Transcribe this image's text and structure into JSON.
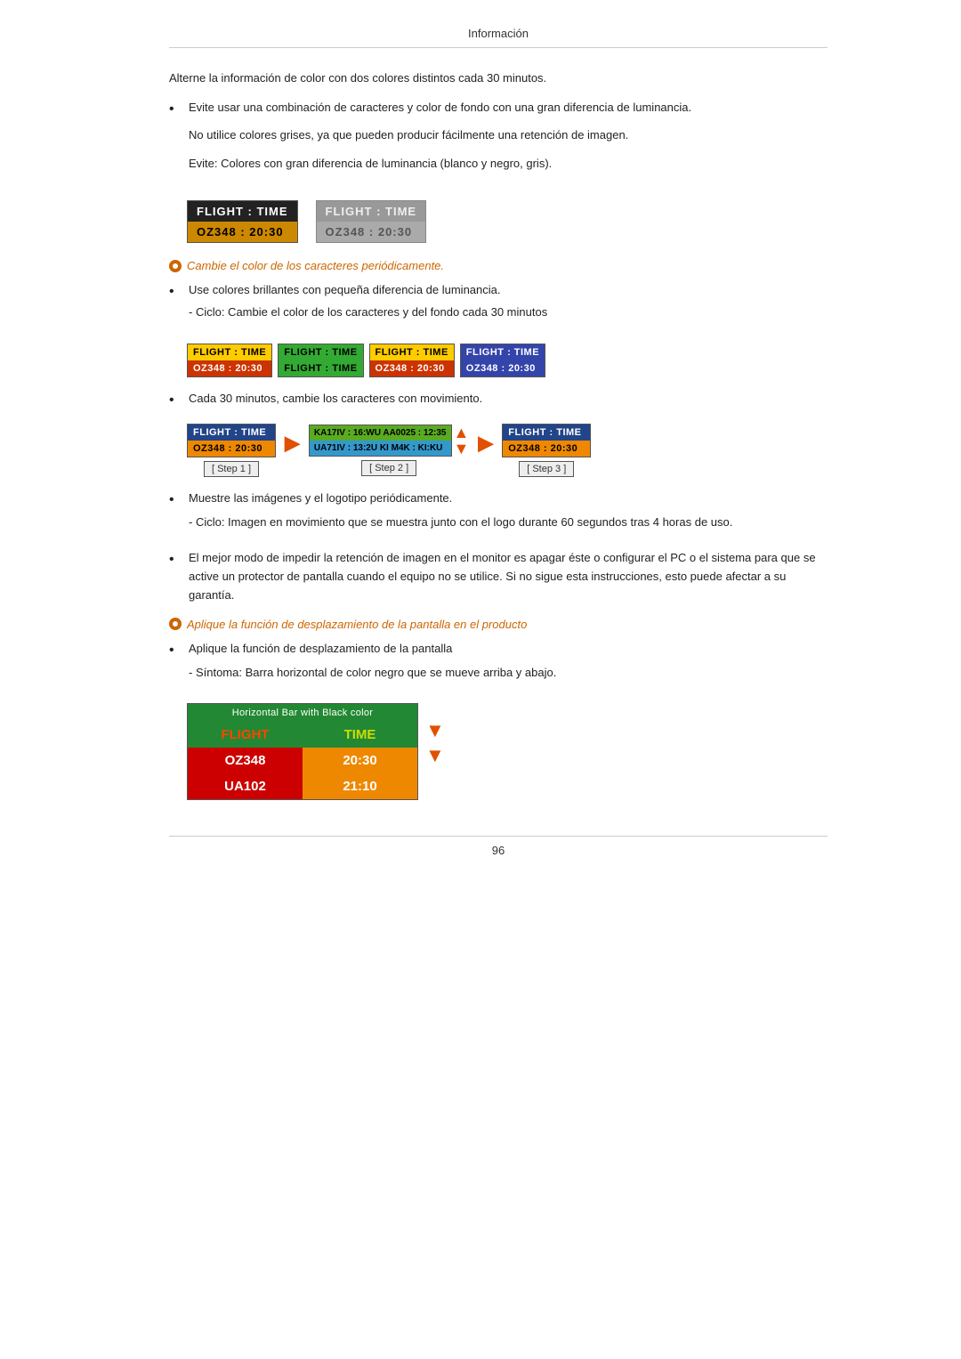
{
  "header": {
    "title": "Información"
  },
  "footer": {
    "page_number": "96"
  },
  "content": {
    "intro_text": "Alterne la información de color con dos colores distintos cada 30 minutos.",
    "bullet1": {
      "text": "Evite usar una combinación de caracteres y color de fondo con una gran diferencia de luminancia.",
      "sub1": "No utilice colores grises, ya que pueden producir fácilmente una retención de imagen.",
      "sub2": "Evite: Colores con gran diferencia de luminancia (blanco y negro, gris)."
    },
    "box_dark": {
      "row1": "FLIGHT  :  TIME",
      "row2": "OZ348   :  20:30"
    },
    "box_gray": {
      "row1": "FLIGHT  :  TIME",
      "row2": "OZ348   :  20:30"
    },
    "orange_heading1": "Cambie el color de los caracteres periódicamente.",
    "bullet2": {
      "text": "Use colores brillantes con pequeña diferencia de luminancia.",
      "sub": "- Ciclo: Cambie el color de los caracteres y del fondo cada 30 minutos"
    },
    "cycle_boxes": [
      {
        "r1": "FLIGHT  :  TIME",
        "r2": "OZ348  :  20:30",
        "class1": "c1-r1",
        "class2": "c1-r2"
      },
      {
        "r1": "FLIGHT  :  TIME",
        "r2": "FLIGHT  :  TIME",
        "class1": "c2-r1",
        "class2": "c2-r2"
      },
      {
        "r1": "FLIGHT  :  TIME",
        "r2": "OZ348  :  20:30",
        "class1": "c3-r1",
        "class2": "c3-r2"
      },
      {
        "r1": "FLIGHT  :  TIME",
        "r2": "OZ348  :  20:30",
        "class1": "c4-r1",
        "class2": "c4-r2"
      }
    ],
    "bullet3": {
      "text": "Cada 30 minutos, cambie los caracteres con movimiento."
    },
    "steps": {
      "step1": {
        "r1": "FLIGHT  :  TIME",
        "r2": "OZ348   :  20:30",
        "label": "[ Step 1 ]"
      },
      "step2": {
        "r1": "KA17IV : 16:WU  AA0025 : 12:35",
        "r2": "UA71IV : 13:2U  KI M4K : KI:KU",
        "label": "[ Step 2 ]"
      },
      "step3": {
        "r1": "FLIGHT  :  TIME",
        "r2": "OZ348   :  20:30",
        "label": "[ Step 3 ]"
      }
    },
    "bullet4": {
      "text": "Muestre las imágenes y el logotipo periódicamente.",
      "sub": "- Ciclo: Imagen en movimiento que se muestra junto con el logo durante 60 segundos tras 4 horas de uso."
    },
    "bullet5": {
      "text": "El mejor modo de impedir la retención de imagen en el monitor es apagar éste o configurar el PC o el sistema para que se active un protector de pantalla cuando el equipo no se utilice. Si no sigue esta instrucciones, esto puede afectar a su garantía."
    },
    "orange_heading2": "Aplique la función de desplazamiento de la pantalla en el producto",
    "bullet6": {
      "text": "Aplique la función de desplazamiento de la pantalla",
      "sub": "- Síntoma: Barra horizontal de color negro que se mueve arriba y abajo."
    },
    "hbar_table": {
      "header": "Horizontal Bar with Black color",
      "row_head": {
        "col1": "FLIGHT",
        "col2": "TIME"
      },
      "row1": {
        "col1": "OZ348",
        "col2": "20:30"
      },
      "row2": {
        "col1": "UA102",
        "col2": "21:10"
      }
    }
  }
}
